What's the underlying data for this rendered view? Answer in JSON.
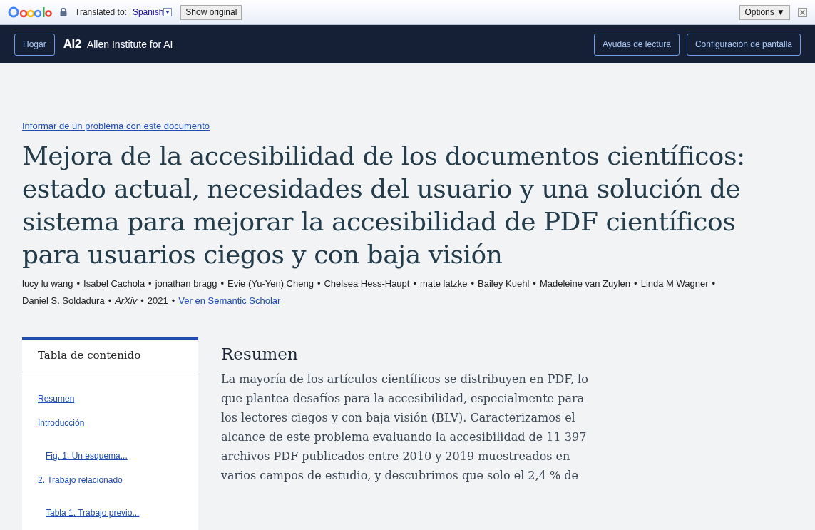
{
  "translate_bar": {
    "label": "Translated to:",
    "language": "Spanish",
    "show_original": "Show original",
    "options": "Options ▼"
  },
  "header": {
    "home": "Hogar",
    "logo": "AI2",
    "org": "Allen Institute for AI",
    "buttons": [
      "Ayudas de lectura",
      "Configuración de pantalla"
    ]
  },
  "report_link": "Informar de un problema con este documento",
  "title": "Mejora de la accesibilidad de los documentos científicos: estado actual, necesidades del usuario y una solución de sistema para mejorar la accesibilidad de PDF científicos para usuarios ciegos y con baja visión",
  "separator": "•",
  "meta": [
    {
      "kind": "author",
      "text": "lucy lu wang"
    },
    {
      "kind": "author",
      "text": "Isabel Cachola"
    },
    {
      "kind": "author",
      "text": "jonathan bragg"
    },
    {
      "kind": "author",
      "text": "Evie (Yu-Yen) Cheng"
    },
    {
      "kind": "author",
      "text": "Chelsea Hess-Haupt"
    },
    {
      "kind": "author",
      "text": "mate latzke"
    },
    {
      "kind": "author",
      "text": "Bailey Kuehl"
    },
    {
      "kind": "author",
      "text": "Madeleine van Zuylen"
    },
    {
      "kind": "author",
      "text": "Linda M Wagner"
    },
    {
      "kind": "author",
      "text": "Daniel S. Soldadura"
    },
    {
      "kind": "venue",
      "text": "ArXiv"
    },
    {
      "kind": "year",
      "text": "2021"
    },
    {
      "kind": "link",
      "text": "Ver en Semantic Scholar"
    }
  ],
  "toc": {
    "title": "Tabla de contenido",
    "items": [
      {
        "label": "Resumen"
      },
      {
        "label": "Introducción",
        "children": [
          {
            "label": "Fig. 1. Un esquema..."
          }
        ]
      },
      {
        "label": "2. Trabajo relacionado",
        "children": [
          {
            "label": "Tabla 1. Trabajo previo..."
          }
        ]
      }
    ]
  },
  "section": {
    "heading": "Resumen",
    "body": "La mayoría de los artículos científicos se distribuyen en PDF, lo que plantea desafíos para la accesibilidad, especialmente para los lectores ciegos y con baja visión (BLV). Caracterizamos el alcance de este problema evaluando la accesibilidad de 11 397 archivos PDF publicados entre 2010 y 2019 muestreados en varios campos de estudio, y descubrimos que solo el 2,4 % de"
  }
}
